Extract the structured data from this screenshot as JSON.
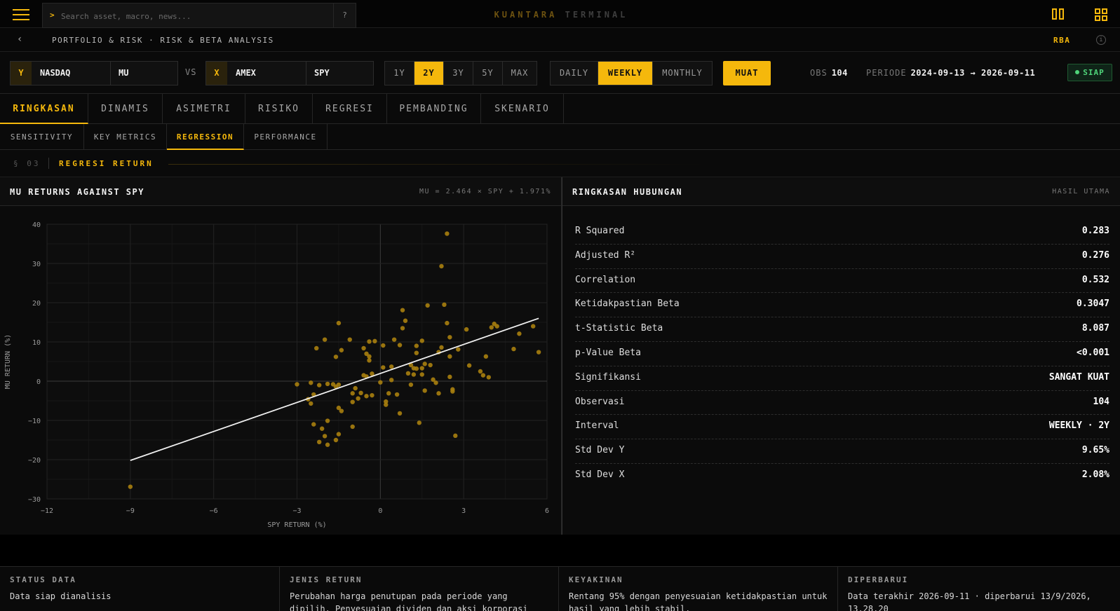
{
  "search": {
    "prompt": ">",
    "placeholder": "Search asset, macro, news...",
    "help": "?"
  },
  "brand": {
    "part1": "KUANTARA",
    "part2": "TERMINAL"
  },
  "breadcrumb": {
    "text": "PORTFOLIO & RISK · RISK & BETA ANALYSIS",
    "code": "RBA"
  },
  "pair": {
    "y": {
      "tag": "Y",
      "exchange": "NASDAQ",
      "ticker": "MU"
    },
    "vs": "VS",
    "x": {
      "tag": "X",
      "exchange": "AMEX",
      "ticker": "SPY"
    }
  },
  "ranges": {
    "options": [
      "1Y",
      "2Y",
      "3Y",
      "5Y",
      "MAX"
    ],
    "selected": "2Y"
  },
  "intervals": {
    "options": [
      "DAILY",
      "WEEKLY",
      "MONTHLY"
    ],
    "selected": "WEEKLY"
  },
  "load_label": "MUAT",
  "stats": {
    "obs_label": "OBS",
    "obs_value": "104",
    "period_label": "PERIODE",
    "period_value": "2024-09-13 → 2026-09-11"
  },
  "status_badge": "SIAP",
  "tabs": [
    "RINGKASAN",
    "DINAMIS",
    "ASIMETRI",
    "RISIKO",
    "REGRESI",
    "PEMBANDING",
    "SKENARIO"
  ],
  "subtabs": [
    "SENSITIVITY",
    "KEY METRICS",
    "REGRESSION",
    "PERFORMANCE"
  ],
  "section": {
    "number": "§ 03",
    "title": "REGRESI RETURN"
  },
  "chart_panel": {
    "title": "MU RETURNS AGAINST SPY",
    "equation": "MU = 2.464 × SPY + 1.971%"
  },
  "summary_panel": {
    "title": "RINGKASAN HUBUNGAN",
    "subtitle": "HASIL UTAMA",
    "rows": [
      {
        "label": "R Squared",
        "value": "0.283"
      },
      {
        "label": "Adjusted R²",
        "value": "0.276"
      },
      {
        "label": "Correlation",
        "value": "0.532"
      },
      {
        "label": "Ketidakpastian Beta",
        "value": "0.3047"
      },
      {
        "label": "t-Statistic Beta",
        "value": "8.087"
      },
      {
        "label": "p-Value Beta",
        "value": "<0.001"
      },
      {
        "label": "Signifikansi",
        "value": "SANGAT KUAT"
      },
      {
        "label": "Observasi",
        "value": "104"
      },
      {
        "label": "Interval",
        "value": "WEEKLY · 2Y"
      },
      {
        "label": "Std Dev Y",
        "value": "9.65%"
      },
      {
        "label": "Std Dev X",
        "value": "2.08%"
      }
    ]
  },
  "footer": [
    {
      "title": "STATUS DATA",
      "body": "Data siap dianalisis"
    },
    {
      "title": "JENIS RETURN",
      "body": "Perubahan harga penutupan pada periode yang dipilih. Penyesuaian dividen dan aksi korporasi"
    },
    {
      "title": "KEYAKINAN",
      "body": "Rentang 95% dengan penyesuaian ketidakpastian untuk hasil yang lebih stabil."
    },
    {
      "title": "DIPERBARUI",
      "body": "Data terakhir 2026-09-11 · diperbarui 13/9/2026, 13.28.20"
    }
  ],
  "colors": {
    "accent": "#f5b80c",
    "point": "#a97f0e",
    "regression_line": "#f0f0f0",
    "ready": "#4fd47a"
  },
  "icons": {
    "menu": "hamburger-icon",
    "columns": "columns-icon",
    "grid": "grid-icon",
    "back": "chevron-left-icon",
    "info": "info-icon"
  },
  "chart_data": {
    "type": "scatter",
    "title": "MU RETURNS AGAINST SPY",
    "xlabel": "SPY RETURN (%)",
    "ylabel": "MU RETURN (%)",
    "xlim": [
      -12,
      6
    ],
    "ylim": [
      -30,
      40
    ],
    "x_ticks": [
      -12,
      -9,
      -6,
      -3,
      0,
      3,
      6
    ],
    "y_ticks": [
      -30,
      -20,
      -10,
      0,
      10,
      20,
      30,
      40
    ],
    "grid": true,
    "regression": {
      "slope": 2.464,
      "intercept": 1.971,
      "x_range": [
        -9.0,
        5.7
      ]
    },
    "points": [
      [
        -9.0,
        -26.9
      ],
      [
        -3.0,
        -0.8
      ],
      [
        -2.3,
        8.4
      ],
      [
        -2.5,
        -0.4
      ],
      [
        -2.4,
        -3.4
      ],
      [
        -2.6,
        -4.6
      ],
      [
        -2.5,
        -5.7
      ],
      [
        -2.2,
        -1.0
      ],
      [
        -1.9,
        -0.7
      ],
      [
        -2.0,
        10.6
      ],
      [
        -2.4,
        -11.0
      ],
      [
        -2.1,
        -12.1
      ],
      [
        -2.0,
        -14.0
      ],
      [
        -1.9,
        -10.1
      ],
      [
        -2.2,
        -15.5
      ],
      [
        -1.9,
        -16.2
      ],
      [
        -1.6,
        -15.0
      ],
      [
        -1.5,
        -13.5
      ],
      [
        -1.6,
        -1.4
      ],
      [
        -1.5,
        -0.9
      ],
      [
        -1.7,
        -0.8
      ],
      [
        -1.6,
        6.2
      ],
      [
        -1.5,
        14.8
      ],
      [
        -1.4,
        7.9
      ],
      [
        -1.5,
        -6.8
      ],
      [
        -1.4,
        -7.6
      ],
      [
        -1.1,
        10.6
      ],
      [
        -1.0,
        -11.6
      ],
      [
        -1.0,
        -3.1
      ],
      [
        -1.0,
        -5.3
      ],
      [
        -0.8,
        -4.4
      ],
      [
        -0.9,
        -1.8
      ],
      [
        -0.7,
        -3.0
      ],
      [
        -0.6,
        1.5
      ],
      [
        -0.5,
        1.2
      ],
      [
        -0.6,
        8.4
      ],
      [
        -0.5,
        7.0
      ],
      [
        -0.4,
        6.3
      ],
      [
        -0.4,
        5.3
      ],
      [
        -0.4,
        10.1
      ],
      [
        -0.2,
        10.2
      ],
      [
        -0.3,
        1.9
      ],
      [
        -0.3,
        -3.6
      ],
      [
        -0.5,
        -3.8
      ],
      [
        0.0,
        -0.3
      ],
      [
        0.1,
        9.1
      ],
      [
        0.1,
        3.5
      ],
      [
        0.2,
        -6.0
      ],
      [
        0.2,
        -5.2
      ],
      [
        0.3,
        -3.1
      ],
      [
        0.4,
        0.3
      ],
      [
        0.4,
        3.7
      ],
      [
        0.5,
        10.6
      ],
      [
        0.6,
        -3.4
      ],
      [
        0.7,
        9.2
      ],
      [
        0.8,
        13.5
      ],
      [
        0.8,
        18.1
      ],
      [
        0.7,
        -8.2
      ],
      [
        0.9,
        15.4
      ],
      [
        1.0,
        2.0
      ],
      [
        1.1,
        4.1
      ],
      [
        1.2,
        3.3
      ],
      [
        1.1,
        -0.9
      ],
      [
        1.3,
        9.0
      ],
      [
        1.3,
        3.2
      ],
      [
        1.3,
        7.2
      ],
      [
        1.5,
        3.3
      ],
      [
        1.5,
        1.7
      ],
      [
        1.6,
        4.4
      ],
      [
        1.4,
        -10.6
      ],
      [
        1.2,
        1.7
      ],
      [
        1.5,
        10.3
      ],
      [
        1.6,
        -2.4
      ],
      [
        1.7,
        19.3
      ],
      [
        1.8,
        4.1
      ],
      [
        1.9,
        0.4
      ],
      [
        2.0,
        -0.4
      ],
      [
        2.1,
        7.4
      ],
      [
        2.1,
        -3.1
      ],
      [
        2.2,
        8.6
      ],
      [
        2.3,
        19.5
      ],
      [
        2.4,
        14.8
      ],
      [
        2.5,
        11.2
      ],
      [
        2.5,
        6.3
      ],
      [
        2.6,
        -2.1
      ],
      [
        2.6,
        -2.6
      ],
      [
        2.2,
        29.3
      ],
      [
        2.5,
        1.1
      ],
      [
        2.8,
        8.1
      ],
      [
        3.1,
        13.2
      ],
      [
        3.2,
        4.0
      ],
      [
        2.7,
        -13.9
      ],
      [
        2.4,
        37.6
      ],
      [
        3.8,
        6.3
      ],
      [
        3.9,
        1.0
      ],
      [
        4.0,
        13.7
      ],
      [
        4.1,
        14.6
      ],
      [
        4.2,
        14.0
      ],
      [
        3.6,
        2.5
      ],
      [
        3.7,
        1.5
      ],
      [
        5.5,
        14.0
      ],
      [
        5.7,
        7.4
      ],
      [
        4.8,
        8.2
      ],
      [
        5.0,
        12.1
      ]
    ]
  }
}
